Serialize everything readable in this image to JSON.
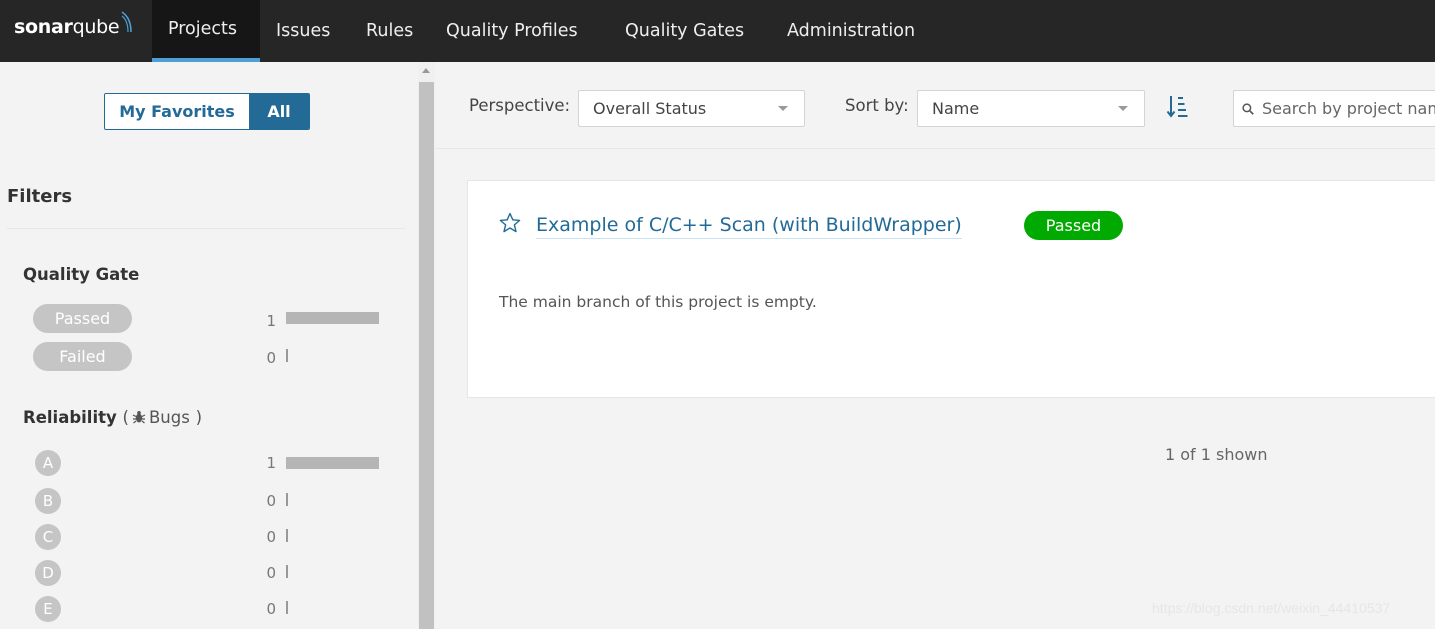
{
  "nav": {
    "logo_bold": "sonar",
    "logo_light": "qube",
    "items": [
      {
        "label": "Projects",
        "active": true
      },
      {
        "label": "Issues"
      },
      {
        "label": "Rules"
      },
      {
        "label": "Quality Profiles"
      },
      {
        "label": "Quality Gates"
      },
      {
        "label": "Administration"
      }
    ]
  },
  "sidebar": {
    "toggle": {
      "favorites": "My Favorites",
      "all": "All",
      "selected": "All"
    },
    "filters_title": "Filters",
    "quality_gate": {
      "title": "Quality Gate",
      "options": [
        {
          "label": "Passed",
          "count": "1",
          "fraction": 1.0
        },
        {
          "label": "Failed",
          "count": "0",
          "fraction": 0
        }
      ]
    },
    "reliability": {
      "title": "Reliability",
      "paren_open": "(",
      "sub_label": "Bugs",
      "paren_close": ")",
      "icon": "bug-icon",
      "options": [
        {
          "label": "A",
          "count": "1",
          "fraction": 1.0
        },
        {
          "label": "B",
          "count": "0",
          "fraction": 0
        },
        {
          "label": "C",
          "count": "0",
          "fraction": 0
        },
        {
          "label": "D",
          "count": "0",
          "fraction": 0
        },
        {
          "label": "E",
          "count": "0",
          "fraction": 0
        }
      ]
    }
  },
  "toolbar": {
    "perspective_label": "Perspective:",
    "perspective_value": "Overall Status",
    "sort_label": "Sort by:",
    "sort_value": "Name",
    "search_placeholder": "Search by project name or key"
  },
  "project": {
    "name": "Example of C/C++ Scan (with BuildWrapper)",
    "status": "Passed",
    "message": "The main branch of this project is empty."
  },
  "pagination": {
    "text": "1 of 1 shown"
  },
  "watermark": "https://blog.csdn.net/weixin_44410537",
  "colors": {
    "nav_bg": "#262626",
    "accent": "#236a97",
    "passed_green": "#00aa00",
    "facet_gray": "#c5c5c5"
  }
}
